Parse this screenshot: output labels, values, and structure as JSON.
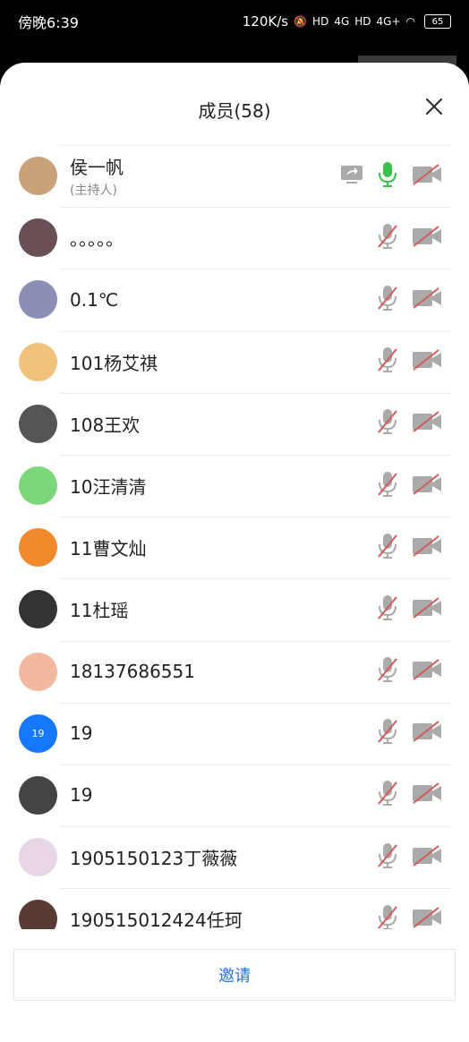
{
  "status_bar": {
    "time": "傍晚6:39",
    "network_speed": "120K/s",
    "battery": "65",
    "icons": [
      "mute-bell-icon",
      "hd-icon",
      "4g-signal-icon",
      "hd-icon",
      "4g-plus-signal-icon",
      "wifi-icon",
      "battery-icon"
    ]
  },
  "panel": {
    "title": "成员(58)",
    "close_icon": "close-icon"
  },
  "members": [
    {
      "name": "侯一帆",
      "role": "(主持人)",
      "avatar_color": "#c9a27a",
      "mic_state": "on",
      "screen_share": true
    },
    {
      "name": "。。。。。",
      "avatar_color": "#6a4f55",
      "mic_state": "muted"
    },
    {
      "name": "0.1℃",
      "avatar_color": "#8b8fb6",
      "mic_state": "muted"
    },
    {
      "name": "101杨艾祺",
      "avatar_color": "#f0c27b",
      "mic_state": "muted"
    },
    {
      "name": "108王欢",
      "avatar_color": "#555555",
      "mic_state": "muted"
    },
    {
      "name": "10汪清清",
      "avatar_color": "#7cd67a",
      "mic_state": "muted"
    },
    {
      "name": "11曹文灿",
      "avatar_color": "#f08a2c",
      "mic_state": "muted"
    },
    {
      "name": "11杜瑶",
      "avatar_color": "#333333",
      "mic_state": "muted"
    },
    {
      "name": "18137686551",
      "avatar_color": "#f2b9a0",
      "mic_state": "muted"
    },
    {
      "name": "19",
      "avatar_text": "19",
      "avatar_color": "#1677ff",
      "mic_state": "muted"
    },
    {
      "name": "19",
      "avatar_color": "#444444",
      "mic_state": "muted"
    },
    {
      "name": "1905150123丁薇薇",
      "avatar_color": "#e8d6e6",
      "mic_state": "muted"
    },
    {
      "name": "190515012424任珂",
      "avatar_color": "#5a3b33",
      "mic_state": "muted"
    }
  ],
  "invite": {
    "label": "邀请"
  },
  "colors": {
    "mic_on": "#3cbf4b",
    "mic_muted": "#d45a5a",
    "icon_gray": "#aaaaaa",
    "accent": "#2b72d4"
  }
}
